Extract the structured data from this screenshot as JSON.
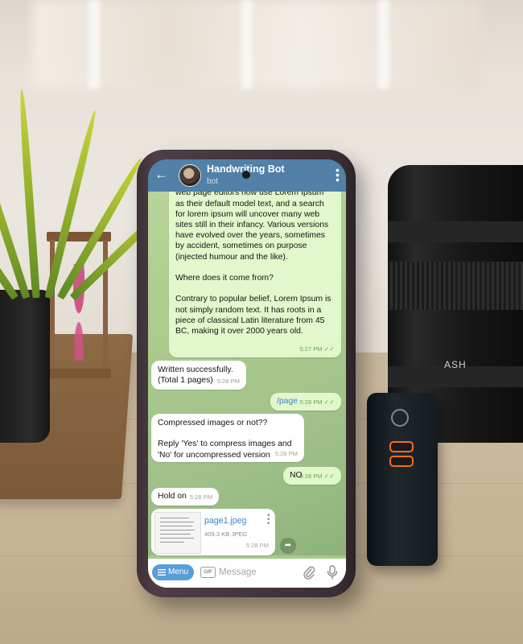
{
  "chat": {
    "bot_name": "Handwriting Bot",
    "bot_subtitle": "bot",
    "messages": [
      {
        "type": "out",
        "text": "here making it look like readable English. Many desktop publishing packages and web page editors now use Lorem Ipsum as their default model text, and a search for lorem ipsum will uncover many web sites still in their infancy. Various versions have evolved over the years, sometimes by accident, sometimes on purpose (injected humour and the like).\n\nWhere does it come from?\n\nContrary to popular belief, Lorem Ipsum is not simply random text. It has roots in a piece of classical Latin literature from 45 BC, making it over 2000 years old.",
        "time": "5:27 PM"
      },
      {
        "type": "in",
        "text": "Written successfully.\n(Total 1 pages)",
        "time": "5:28 PM"
      },
      {
        "type": "out",
        "text": "/page",
        "time": "5:28 PM"
      },
      {
        "type": "in",
        "text": "Compressed images or not??\n\nReply 'Yes' to compress images and 'No' for uncompressed version",
        "time": "5:28 PM"
      },
      {
        "type": "out",
        "text": "NO",
        "time": "5:28 PM"
      },
      {
        "type": "in",
        "text": "Hold on",
        "time": "5:28 PM"
      }
    ],
    "file": {
      "name": "page1.jpeg",
      "size": "409.3 KB JPEG",
      "time": "5:28 PM"
    }
  },
  "input_bar": {
    "menu_label": "Menu",
    "gif_label": "GIF",
    "placeholder": "Message"
  },
  "scene": {
    "lens_text": "ASH"
  },
  "colors": {
    "header": "#5180a9",
    "outgoing_bubble": "#e2f7cb",
    "incoming_bubble": "#ffffff",
    "link": "#3a84c6",
    "menu_button": "#5a9ed8"
  }
}
